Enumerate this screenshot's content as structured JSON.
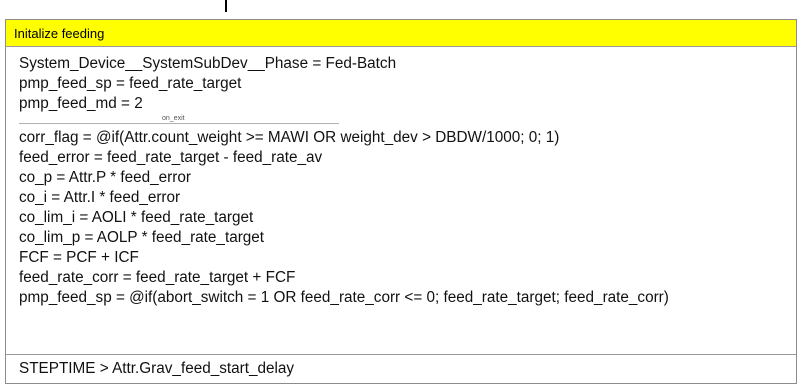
{
  "step": {
    "title": "Initalize feeding",
    "on_entry": [
      "System_Device__SystemSubDev__Phase = Fed-Batch",
      "pmp_feed_sp = feed_rate_target",
      "pmp_feed_md = 2"
    ],
    "separator_label": "on_exit",
    "on_exit": [
      "corr_flag = @if(Attr.count_weight >= MAWI OR weight_dev > DBDW/1000; 0; 1)",
      "feed_error = feed_rate_target - feed_rate_av",
      "co_p = Attr.P * feed_error",
      "co_i = Attr.I * feed_error",
      "co_lim_i = AOLI * feed_rate_target",
      "co_lim_p = AOLP * feed_rate_target",
      "FCF = PCF + ICF",
      "feed_rate_corr = feed_rate_target + FCF",
      "pmp_feed_sp = @if(abort_switch = 1 OR feed_rate_corr <= 0; feed_rate_target; feed_rate_corr)"
    ],
    "transition_condition": "STEPTIME > Attr.Grav_feed_start_delay"
  },
  "colors": {
    "header_background": "#ffff00",
    "border": "#8c8c8c"
  }
}
